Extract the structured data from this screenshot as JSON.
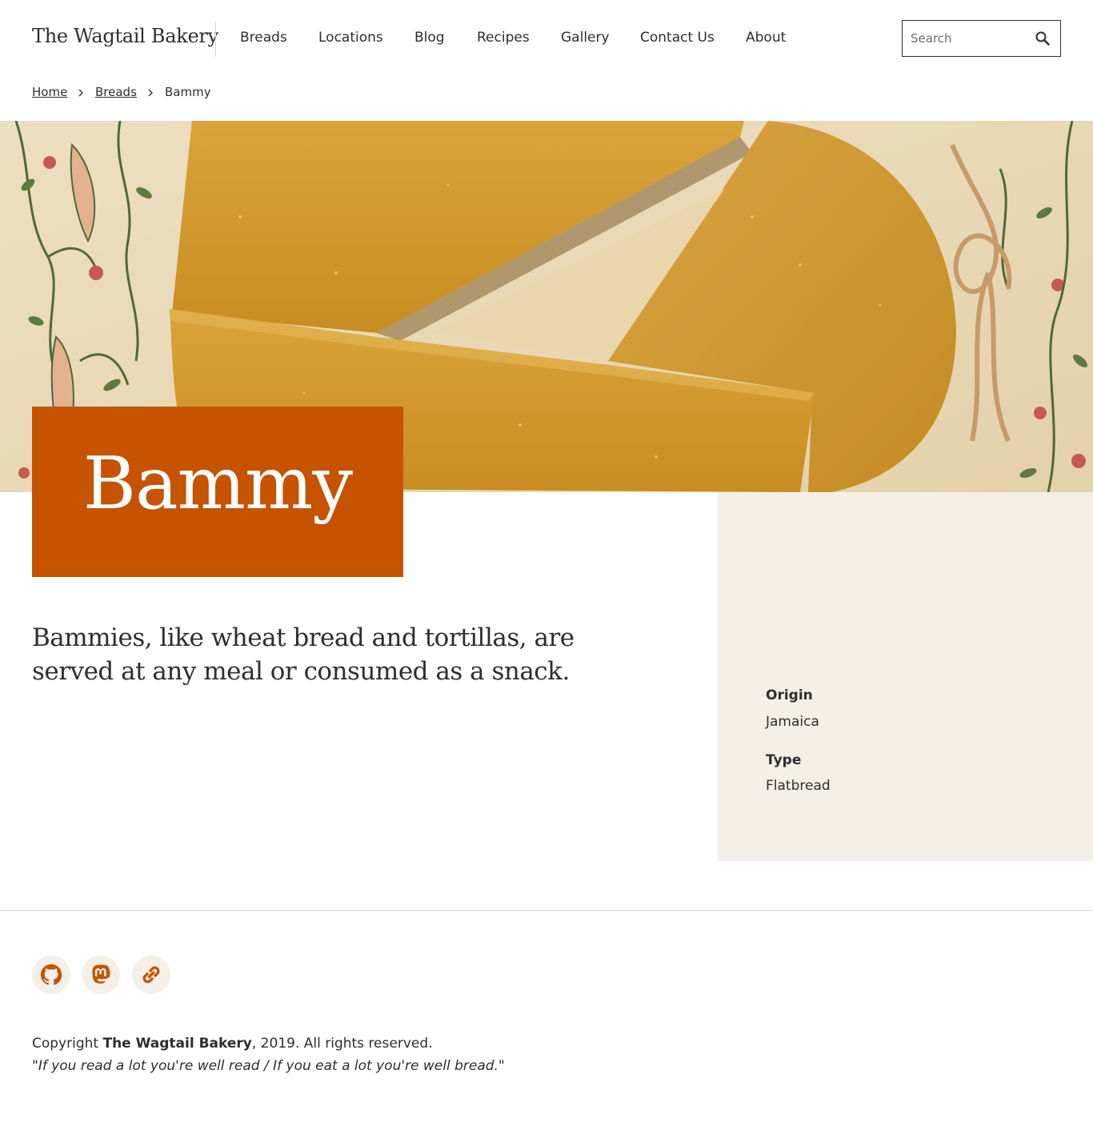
{
  "header": {
    "site_title": "The Wagtail Bakery",
    "nav": [
      "Breads",
      "Locations",
      "Blog",
      "Recipes",
      "Gallery",
      "Contact Us",
      "About"
    ],
    "search": {
      "placeholder": "Search",
      "icon": "magnifier-icon"
    }
  },
  "breadcrumb": {
    "home": "Home",
    "breads": "Breads",
    "current": "Bammy",
    "separator_icon": "chevron-right-icon"
  },
  "page": {
    "title": "Bammy",
    "intro": "Bammies, like wheat bread and tortillas, are served at any meal or consumed as a snack."
  },
  "meta": {
    "origin_label": "Origin",
    "origin_value": "Jamaica",
    "type_label": "Type",
    "type_value": "Flatbread"
  },
  "footer": {
    "social_icons": [
      "github-icon",
      "mastodon-icon",
      "link-icon"
    ],
    "copyright_prefix": "Copyright ",
    "copyright_name": "The Wagtail Bakery",
    "copyright_suffix": ", 2019. All rights reserved.",
    "tagline": "\"If you read a lot you're well read / If you eat a lot you're well bread.\""
  },
  "colors": {
    "accent": "#c65300",
    "sidebar_bg": "#f4f0e8",
    "text": "#2e2e2e"
  }
}
